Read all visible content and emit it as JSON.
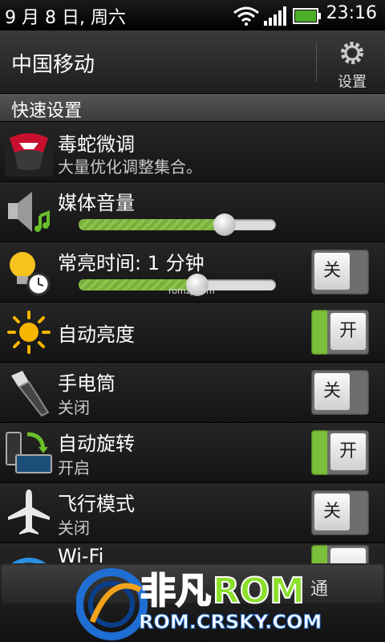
{
  "status_bar": {
    "date": "9 月 8 日, 周六",
    "time": "23:16",
    "icons": [
      "wifi-icon",
      "signal-icon",
      "battery-icon"
    ]
  },
  "header": {
    "carrier": "中国移动",
    "settings_label": "设置"
  },
  "section_title": "快速设置",
  "rows": [
    {
      "title": "毒蛇微调",
      "subtitle": "大量优化调整集合。",
      "icon": "viper-app-icon"
    },
    {
      "title": "媒体音量",
      "icon": "speaker-icon",
      "level": 0.74
    },
    {
      "title": "常亮时间: 1 分钟",
      "icon": "bulb-clock-icon",
      "level": 0.6,
      "toggle": "关"
    },
    {
      "title": "自动亮度",
      "icon": "sun-icon",
      "toggle": "开"
    },
    {
      "title": "手电筒",
      "subtitle": "关闭",
      "icon": "flashlight-icon",
      "toggle": "关"
    },
    {
      "title": "自动旋转",
      "subtitle": "开启",
      "icon": "rotate-icon",
      "toggle": "开"
    },
    {
      "title": "飞行模式",
      "subtitle": "关闭",
      "icon": "airplane-icon",
      "toggle": "关"
    },
    {
      "title": "Wi-Fi",
      "icon": "wifi-row-icon"
    }
  ],
  "watermark": "romzj.com",
  "bottom_button_label": "通",
  "logo": {
    "brand": "非凡ROM",
    "url_text": "ROM.CRSKY.COM"
  },
  "colors": {
    "accent_green": "#7cbf3a",
    "logo_blue": "#1f6ed4",
    "logo_green": "#8be02a"
  }
}
